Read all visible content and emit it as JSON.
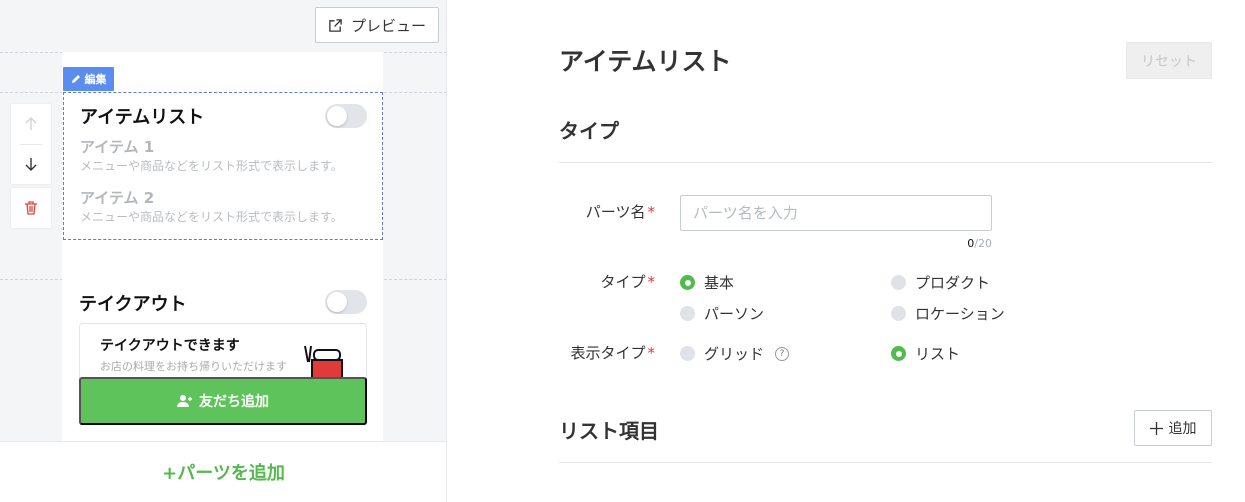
{
  "toolbar": {
    "preview_label": "プレビュー"
  },
  "editor": {
    "edit_tag_label": "編集",
    "item_list_block": {
      "title": "アイテムリスト",
      "items": [
        {
          "title": "アイテム 1",
          "desc": "メニューや商品などをリスト形式で表示します。"
        },
        {
          "title": "アイテム 2",
          "desc": "メニューや商品などをリスト形式で表示します。"
        }
      ]
    },
    "takeout_block": {
      "title": "テイクアウト",
      "card_title": "テイクアウトできます",
      "card_sub": "お店の料理をお持ち帰りいただけます"
    },
    "add_friend_label": "友だち追加",
    "add_parts_label": "+パーツを追加"
  },
  "settings": {
    "title": "アイテムリスト",
    "reset_label": "リセット",
    "type_section": "タイプ",
    "parts_name": {
      "label": "パーツ名",
      "placeholder": "パーツ名を入力",
      "count": "0",
      "max": "/20"
    },
    "type_field": {
      "label": "タイプ",
      "options": [
        "基本",
        "プロダクト",
        "パーソン",
        "ロケーション"
      ],
      "selected": "基本"
    },
    "display_type": {
      "label": "表示タイプ",
      "options": [
        "グリッド",
        "リスト"
      ],
      "selected": "リスト"
    },
    "list_items_section": "リスト項目",
    "add_label": "追加"
  },
  "colors": {
    "accent_green": "#4fbc4b",
    "edit_blue": "#5b8def",
    "required_red": "#e03a3a"
  }
}
